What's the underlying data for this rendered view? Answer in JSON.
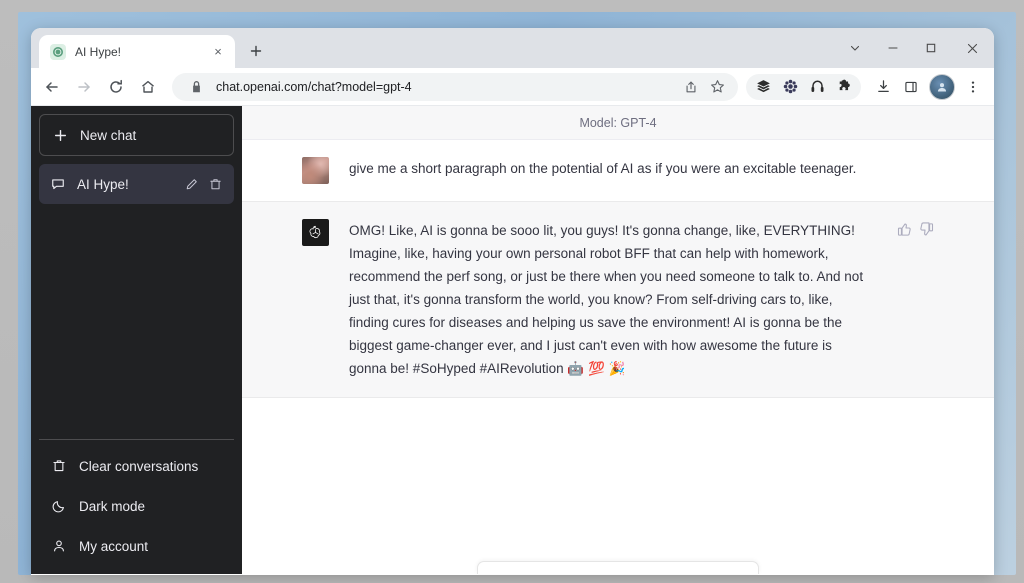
{
  "browser": {
    "tab": {
      "title": "AI Hype!",
      "favicon": "openai-favicon",
      "close_label": "×"
    },
    "new_tab_label": "+",
    "window_controls": {
      "dropdown": "chevron-down",
      "minimize": "minimize",
      "maximize": "maximize",
      "close": "close"
    },
    "nav": {
      "back": "back-arrow",
      "forward": "forward-arrow",
      "reload": "reload",
      "home": "home"
    },
    "omnibox": {
      "lock": "lock-icon",
      "url_highlight": "chat.openai.com/chat",
      "url_dim": "?model=gpt-4",
      "url_full": "chat.openai.com/chat?model=gpt-4",
      "share": "share-icon",
      "bookmark": "star-icon"
    },
    "extensions": [
      "layers-icon",
      "flower-icon",
      "headphones-icon",
      "puzzle-icon"
    ],
    "toolbar_icons": [
      "download-icon",
      "side-panel-icon"
    ],
    "profile": "profile-avatar",
    "menu": "three-dot-menu"
  },
  "sidebar": {
    "new_chat": {
      "label": "New chat",
      "icon": "plus-icon"
    },
    "conversations": [
      {
        "label": "AI Hype!",
        "icon": "chat-bubble-icon",
        "edit_icon": "pencil-icon",
        "delete_icon": "trash-icon",
        "active": true
      }
    ],
    "footer": [
      {
        "label": "Clear conversations",
        "icon": "trash-icon"
      },
      {
        "label": "Dark mode",
        "icon": "moon-icon"
      },
      {
        "label": "My account",
        "icon": "person-icon"
      }
    ]
  },
  "chat": {
    "model_label": "Model: GPT-4",
    "messages": [
      {
        "role": "user",
        "avatar": "user-photo-avatar",
        "text": "give me a short paragraph on the potential of AI as if you were an excitable teenager."
      },
      {
        "role": "assistant",
        "avatar": "openai-logo-avatar",
        "text": "OMG! Like, AI is gonna be sooo lit, you guys! It's gonna change, like, EVERYTHING! Imagine, like, having your own personal robot BFF that can help with homework, recommend the perf song, or just be there when you need someone to talk to. And not just that, it's gonna transform the world, you know? From self-driving cars to, like, finding cures for diseases and helping us save the environment! AI is gonna be the biggest game-changer ever, and I just can't even with how awesome the future is gonna be! #SoHyped #AIRevolution ",
        "emojis": "🤖 💯 🎉",
        "actions": {
          "thumbs_up": "thumbs-up-icon",
          "thumbs_down": "thumbs-down-icon"
        }
      }
    ]
  },
  "colors": {
    "sidebar_bg": "#202123",
    "sidebar_active": "#343541",
    "assistant_row_bg": "#f7f7f8",
    "user_row_bg": "#ffffff",
    "text": "#343541",
    "muted": "#6e6e80"
  }
}
